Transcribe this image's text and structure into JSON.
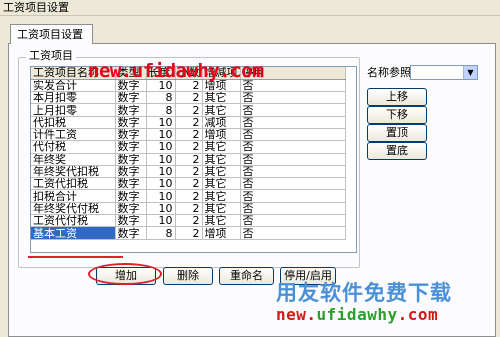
{
  "window": {
    "title": "工资项目设置"
  },
  "tab": {
    "label": "工资项目设置"
  },
  "group": {
    "label": "工资项目"
  },
  "grid": {
    "headers": [
      "工资项目名称",
      "类型",
      "长度",
      "小数",
      "增减项",
      "停用"
    ],
    "rows": [
      [
        "实发合计",
        "数字",
        "10",
        "2",
        "增项",
        "否"
      ],
      [
        "本月扣零",
        "数字",
        "8",
        "2",
        "其它",
        "否"
      ],
      [
        "上月扣零",
        "数字",
        "8",
        "2",
        "其它",
        "否"
      ],
      [
        "代扣税",
        "数字",
        "10",
        "2",
        "减项",
        "否"
      ],
      [
        "计件工资",
        "数字",
        "10",
        "2",
        "增项",
        "否"
      ],
      [
        "代付税",
        "数字",
        "10",
        "2",
        "其它",
        "否"
      ],
      [
        "年终奖",
        "数字",
        "10",
        "2",
        "其它",
        "否"
      ],
      [
        "年终奖代扣税",
        "数字",
        "10",
        "2",
        "其它",
        "否"
      ],
      [
        "工资代扣税",
        "数字",
        "10",
        "2",
        "其它",
        "否"
      ],
      [
        "扣税合计",
        "数字",
        "10",
        "2",
        "其它",
        "否"
      ],
      [
        "年终奖代付税",
        "数字",
        "10",
        "2",
        "其它",
        "否"
      ],
      [
        "工资代付税",
        "数字",
        "10",
        "2",
        "其它",
        "否"
      ],
      [
        "基本工资",
        "数字",
        "8",
        "2",
        "增项",
        "否"
      ]
    ],
    "selected_row_index": 12
  },
  "name_ref": {
    "label": "名称参照",
    "value": ""
  },
  "side_buttons": {
    "up": "上移",
    "down": "下移",
    "top": "置顶",
    "bottom": "置底"
  },
  "bottom_buttons": {
    "add": "增加",
    "delete": "删除",
    "rename": "重命名",
    "toggle": "停用/启用"
  },
  "watermarks": {
    "url_top": "new.ufidawhy.com",
    "cn": "用友软件免费下载",
    "url_bottom_a": "new.",
    "url_bottom_b": "ufidawhy",
    "url_bottom_c": ".com"
  },
  "colors": {
    "selection": "#316ac5",
    "annotation_red": "#e0202a",
    "watermark_blue": "#4a90d9"
  }
}
